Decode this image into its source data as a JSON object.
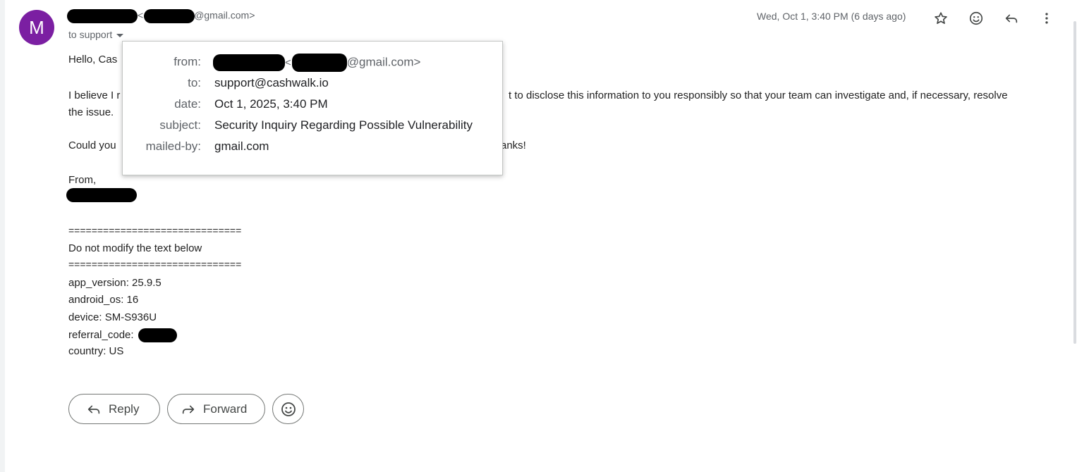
{
  "sender": {
    "avatar_letter": "M",
    "open_bracket": "<",
    "email_domain": "@gmail.com>",
    "to_line": "to support"
  },
  "header": {
    "date": "Wed, Oct 1, 3:40 PM (6 days ago)",
    "icons": [
      "star-icon",
      "emoji-icon",
      "reply-icon",
      "more-vert-icon"
    ]
  },
  "popup": {
    "from_label": "from:",
    "from_bracket": "<",
    "from_domain": "@gmail.com>",
    "to_label": "to:",
    "to_value": "support@cashwalk.io",
    "date_label": "date:",
    "date_value": "Oct 1, 2025, 3:40 PM",
    "subject_label": "subject:",
    "subject_value": "Security Inquiry Regarding Possible Vulnerability",
    "mailed_by_label": "mailed-by:",
    "mailed_by_value": "gmail.com"
  },
  "body": {
    "greeting": "Hello, Cas",
    "para1_start": "I believe I r",
    "para1_end": "t to disclose this information to you responsibly so that your team can investigate and, if necessary, resolve",
    "para1_line2": "the issue.",
    "para2_start": "Could you",
    "para2_end": "anks!",
    "from": "From,",
    "divider": "==============================",
    "do_not_modify": "Do not modify the text below",
    "app_version": "app_version: 25.9.5",
    "android_os": "android_os: 16",
    "device": "device: SM-S936U",
    "referral_code_label": "referral_code:",
    "country": "country: US"
  },
  "actions": {
    "reply_label": "Reply",
    "forward_label": "Forward"
  },
  "colors": {
    "avatar": "#7b1fa2",
    "muted_text": "#5f6368"
  }
}
